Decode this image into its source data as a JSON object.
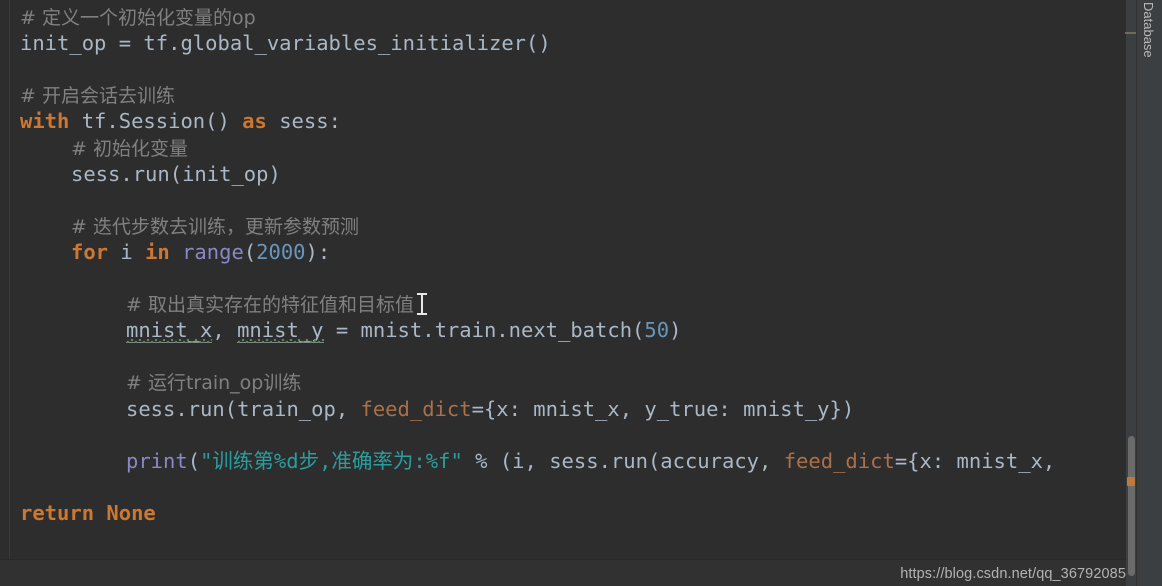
{
  "editor": {
    "background_color": "#2d2d2d",
    "window_background_color": "#2b2b2b",
    "font_size_px": 20.5,
    "lines": [
      {
        "n": 1,
        "indent": 0,
        "tokens": [
          {
            "kind": "comment",
            "text": "# 定义一个初始化变量的op"
          }
        ]
      },
      {
        "n": 2,
        "indent": 0,
        "tokens": [
          {
            "kind": "default",
            "text": "init_op = tf.global_variables_initializer()"
          }
        ]
      },
      {
        "n": 3,
        "indent": 0,
        "tokens": []
      },
      {
        "n": 4,
        "indent": 0,
        "tokens": [
          {
            "kind": "comment",
            "text": "# 开启会话去训练"
          }
        ]
      },
      {
        "n": 5,
        "indent": 0,
        "tokens": [
          {
            "kind": "keyword",
            "text": "with"
          },
          {
            "kind": "default",
            "text": " tf.Session() "
          },
          {
            "kind": "keyword",
            "text": "as"
          },
          {
            "kind": "default",
            "text": " sess:"
          }
        ]
      },
      {
        "n": 6,
        "indent": 1,
        "tokens": [
          {
            "kind": "comment",
            "text": "# 初始化变量"
          }
        ]
      },
      {
        "n": 7,
        "indent": 1,
        "tokens": [
          {
            "kind": "default",
            "text": "sess.run(init_op)"
          }
        ]
      },
      {
        "n": 8,
        "indent": 1,
        "tokens": []
      },
      {
        "n": 9,
        "indent": 1,
        "tokens": [
          {
            "kind": "comment",
            "text": "# 迭代步数去训练，更新参数预测"
          }
        ]
      },
      {
        "n": 10,
        "indent": 1,
        "tokens": [
          {
            "kind": "keyword",
            "text": "for"
          },
          {
            "kind": "default",
            "text": " i "
          },
          {
            "kind": "keyword",
            "text": "in"
          },
          {
            "kind": "default",
            "text": " "
          },
          {
            "kind": "builtin",
            "text": "range"
          },
          {
            "kind": "default",
            "text": "("
          },
          {
            "kind": "number",
            "text": "2000"
          },
          {
            "kind": "default",
            "text": "):"
          }
        ]
      },
      {
        "n": 11,
        "indent": 2,
        "tokens": []
      },
      {
        "n": 12,
        "indent": 2,
        "tokens": [
          {
            "kind": "comment",
            "text": "# 取出真实存在的特征值和目标值"
          }
        ]
      },
      {
        "n": 13,
        "indent": 2,
        "tokens": [
          {
            "kind": "squiggle",
            "text": "mnist_x"
          },
          {
            "kind": "default",
            "text": ", "
          },
          {
            "kind": "squiggle",
            "text": "mnist_y"
          },
          {
            "kind": "default",
            "text": " = mnist.train.next_batch("
          },
          {
            "kind": "number",
            "text": "50"
          },
          {
            "kind": "default",
            "text": ")"
          }
        ]
      },
      {
        "n": 14,
        "indent": 2,
        "tokens": []
      },
      {
        "n": 15,
        "indent": 2,
        "tokens": [
          {
            "kind": "comment",
            "text": "# 运行train_op训练"
          }
        ]
      },
      {
        "n": 16,
        "indent": 2,
        "tokens": [
          {
            "kind": "default",
            "text": "sess.run(train_op, "
          },
          {
            "kind": "kwarg",
            "text": "feed_dict"
          },
          {
            "kind": "default",
            "text": "={x: mnist_x, y_true: mnist_y})"
          }
        ]
      },
      {
        "n": 17,
        "indent": 2,
        "tokens": []
      },
      {
        "n": 18,
        "indent": 2,
        "tokens": [
          {
            "kind": "builtin",
            "text": "print"
          },
          {
            "kind": "default",
            "text": "("
          },
          {
            "kind": "string",
            "text": "\"训练第%d步,准确率为:%f\""
          },
          {
            "kind": "default",
            "text": " % (i, sess.run(accuracy, "
          },
          {
            "kind": "kwarg",
            "text": "feed_dict"
          },
          {
            "kind": "default",
            "text": "={x: mnist_x,"
          }
        ]
      },
      {
        "n": 19,
        "indent": 0,
        "tokens": []
      },
      {
        "n": 20,
        "indent": 0,
        "tokens": [
          {
            "kind": "keyword",
            "text": "return None"
          }
        ]
      }
    ]
  },
  "toolwindow": {
    "database_tab_label": "Database"
  },
  "watermark": {
    "text": "https://blog.csdn.net/qq_36792085"
  },
  "colors": {
    "comment": "#808080",
    "keyword": "#cc7832",
    "number": "#6897bb",
    "builtin": "#8888c6",
    "string": "#2a9e9e",
    "kwarg": "#aa704a",
    "default_text": "#a9b7c6",
    "squiggle": "#6a8759",
    "scrollbar_thumb": "#6b6b6b",
    "warning_marker": "#bc7b3c"
  }
}
